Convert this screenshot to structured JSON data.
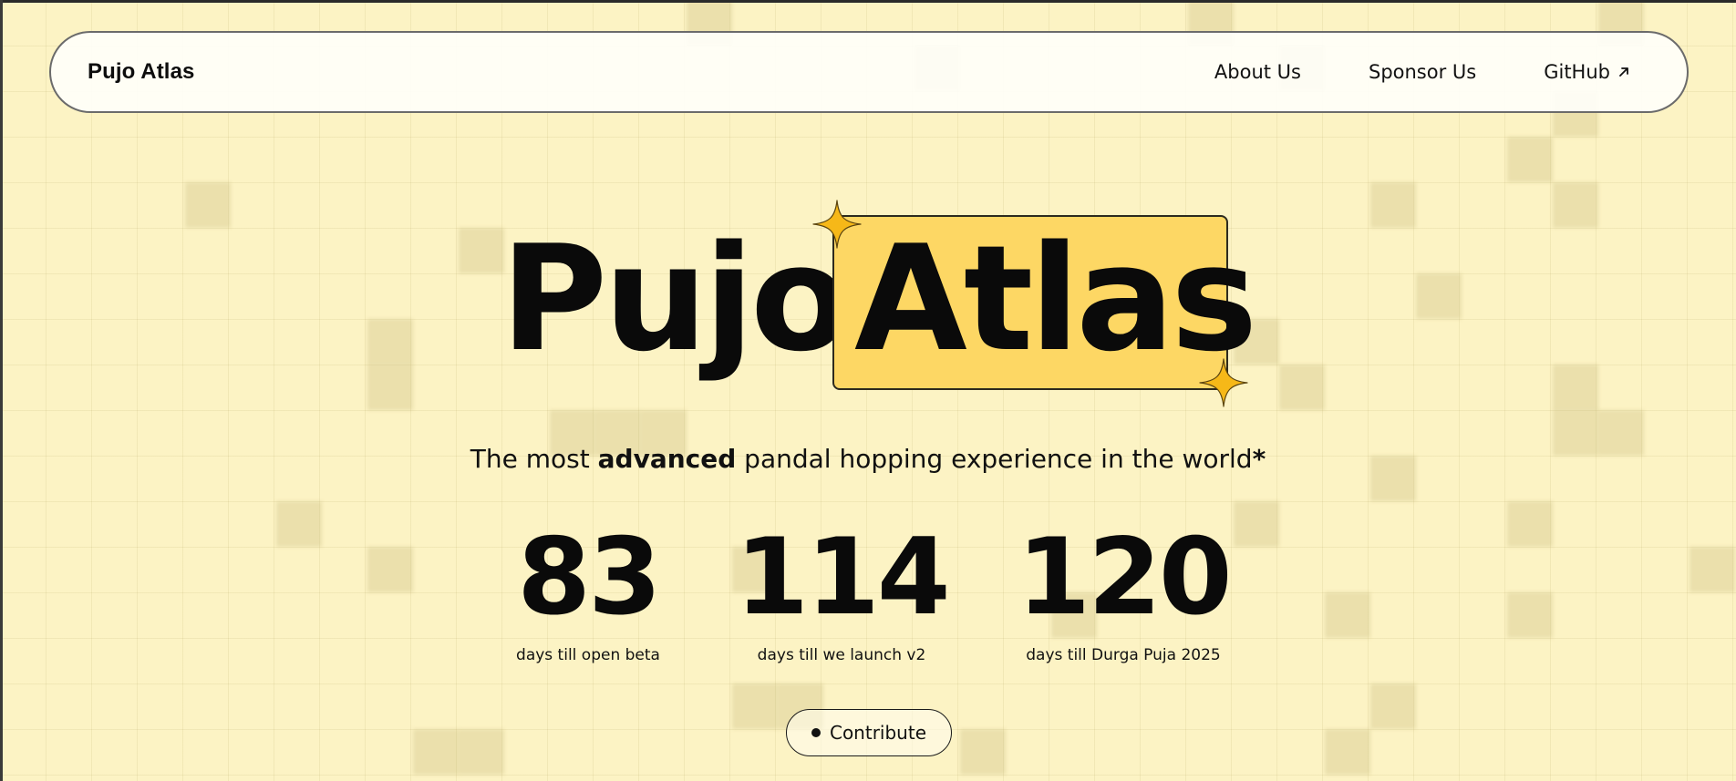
{
  "nav": {
    "brand": "Pujo Atlas",
    "links": [
      {
        "label": "About Us"
      },
      {
        "label": "Sponsor Us"
      },
      {
        "label": "GitHub",
        "icon": "external-link-arrow-icon"
      }
    ]
  },
  "hero": {
    "title_part1": "Pujo",
    "title_part2": "Atlas",
    "tagline_before": "The most ",
    "tagline_bold": "advanced",
    "tagline_after": " pandal hopping experience in the world",
    "tagline_asterisk": "*",
    "countdowns": [
      {
        "number": "83",
        "label": "days till open beta"
      },
      {
        "number": "114",
        "label": "days till we launch v2"
      },
      {
        "number": "120",
        "label": "days till Durga Puja 2025"
      }
    ],
    "contribute_label": "Contribute"
  },
  "colors": {
    "background": "#fcf3c4",
    "highlight": "#fdd764",
    "sparkle": "#f6b818",
    "text": "#0d0d0d"
  },
  "icons": {
    "sparkle": "four-point-star-icon",
    "contribute_dot": "dot-icon"
  }
}
